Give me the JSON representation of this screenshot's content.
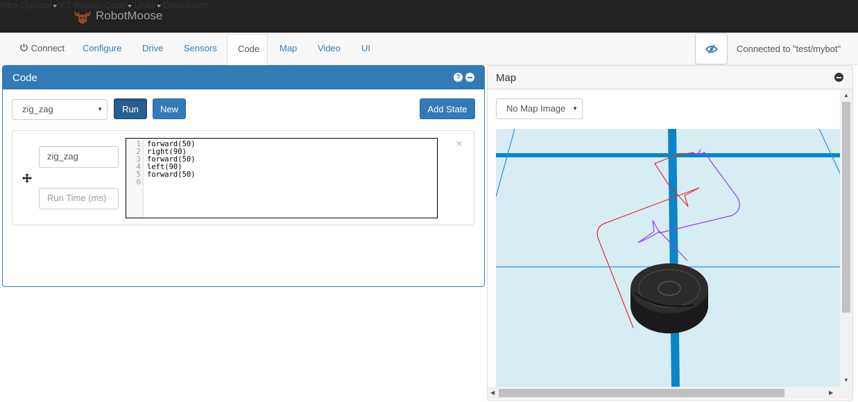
{
  "navbar": {
    "brand": "RobotMoose",
    "items": [
      {
        "label": "Intro",
        "dropdown": false
      },
      {
        "label": "Quizbot",
        "dropdown": true
      },
      {
        "label": "KT",
        "dropdown": false
      },
      {
        "label": "Robots",
        "dropdown": false
      },
      {
        "label": "Code",
        "dropdown": true
      },
      {
        "label": "Links",
        "dropdown": true
      },
      {
        "label": "Downloads",
        "dropdown": false
      }
    ]
  },
  "tabs": {
    "connect": "Connect",
    "configure": "Configure",
    "drive": "Drive",
    "sensors": "Sensors",
    "code": "Code",
    "map": "Map",
    "video": "Video",
    "ui": "UI",
    "active": "Code"
  },
  "status": {
    "connection_text": "Connected to \"test/mybot\""
  },
  "code_panel": {
    "title": "Code",
    "help_icon_glyph": "?",
    "program_select_value": "zig_zag",
    "run_label": "Run",
    "new_label": "New",
    "add_state_label": "Add State",
    "state": {
      "name_value": "zig_zag",
      "runtime_placeholder": "Run Time (ms)",
      "close_glyph": "×",
      "line_numbers": [
        "1",
        "2",
        "3",
        "4",
        "5",
        "6"
      ],
      "code_lines": [
        "forward(50)",
        "right(90)",
        "forward(50)",
        "left(90)",
        "forward(50)",
        ""
      ]
    }
  },
  "map_panel": {
    "title": "Map",
    "map_image_select": "No Map Image"
  },
  "colors": {
    "navbar_bg": "#222222",
    "primary": "#337ab7",
    "map_bg": "#d8ecf4",
    "path_red": "#e03030",
    "path_purple": "#9a3cf0"
  }
}
